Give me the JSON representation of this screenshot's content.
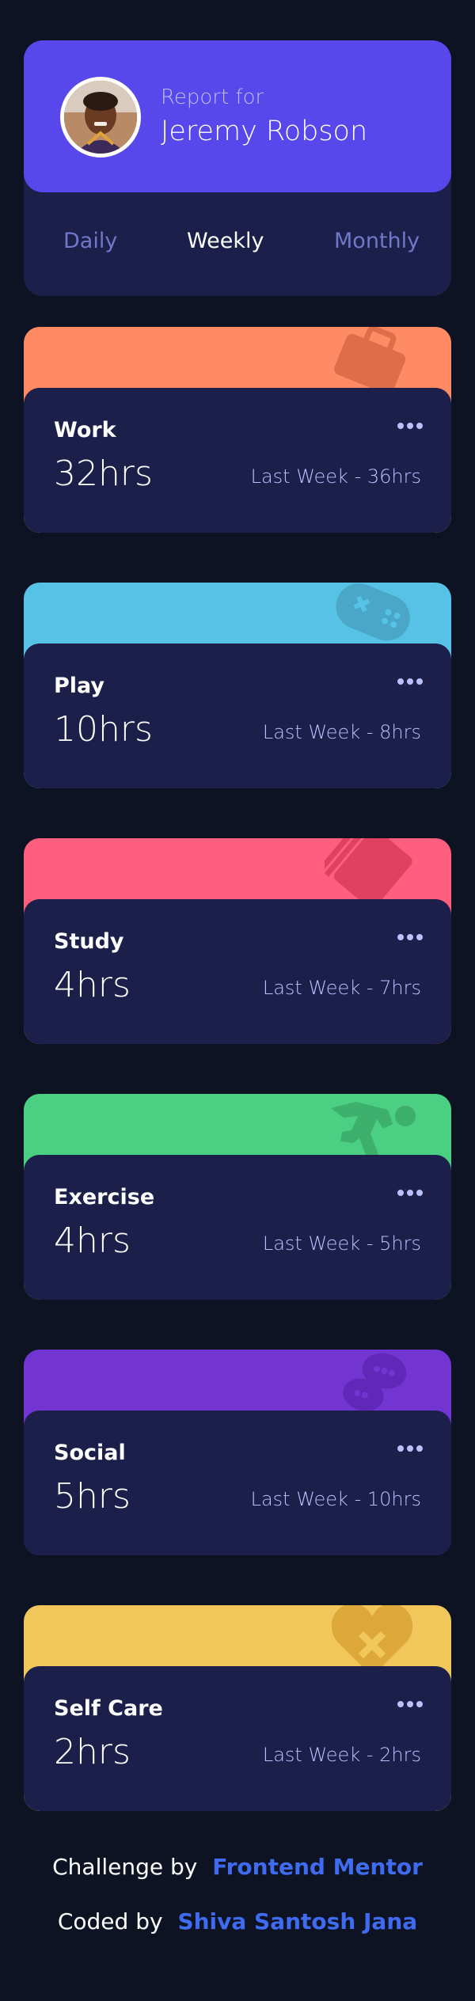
{
  "profile": {
    "report_for": "Report for",
    "name": "Jeremy Robson"
  },
  "tabs": [
    {
      "label": "Daily",
      "active": false
    },
    {
      "label": "Weekly",
      "active": true
    },
    {
      "label": "Monthly",
      "active": false
    }
  ],
  "activities": [
    {
      "title": "Work",
      "hours": "32hrs",
      "last_week": "Last Week - 36hrs",
      "color": "#ff8b64",
      "icon": "briefcase-icon"
    },
    {
      "title": "Play",
      "hours": "10hrs",
      "last_week": "Last Week - 8hrs",
      "color": "#55c2e6",
      "icon": "gamepad-icon"
    },
    {
      "title": "Study",
      "hours": "4hrs",
      "last_week": "Last Week - 7hrs",
      "color": "#ff5e7d",
      "icon": "book-icon"
    },
    {
      "title": "Exercise",
      "hours": "4hrs",
      "last_week": "Last Week - 5hrs",
      "color": "#4bcf82",
      "icon": "running-icon"
    },
    {
      "title": "Social",
      "hours": "5hrs",
      "last_week": "Last Week - 10hrs",
      "color": "#7335d2",
      "icon": "social-icon"
    },
    {
      "title": "Self Care",
      "hours": "2hrs",
      "last_week": "Last Week - 2hrs",
      "color": "#f1c75b",
      "icon": "heart-icon"
    }
  ],
  "attribution": {
    "challenge_label": "Challenge by",
    "challenge_link": "Frontend Mentor",
    "coded_label": "Coded by",
    "coded_link": "Shiva Santosh Jana"
  }
}
